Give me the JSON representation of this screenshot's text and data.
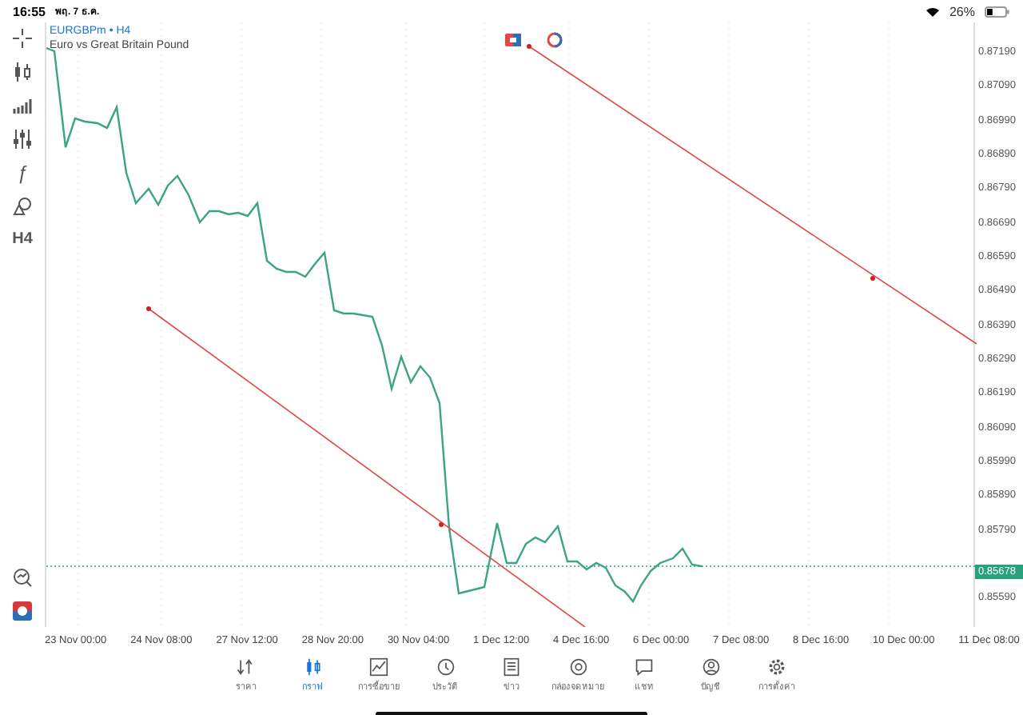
{
  "status_bar": {
    "time": "16:55",
    "date": "พฤ. 7 ธ.ค.",
    "battery": "26%"
  },
  "symbol": {
    "name": "EURGBPm",
    "timeframe": "• H4",
    "description": "Euro vs Great Britain Pound"
  },
  "toolbar": [
    {
      "kind": "crosshair"
    },
    {
      "kind": "candles"
    },
    {
      "kind": "indicators"
    },
    {
      "kind": "sliders"
    },
    {
      "kind": "text",
      "label": "ƒ"
    },
    {
      "kind": "objects"
    },
    {
      "kind": "text",
      "label": "H4"
    }
  ],
  "price_axis": [
    {
      "kind": "tick",
      "label": "0.87190"
    },
    {
      "kind": "tick",
      "label": "0.87090"
    },
    {
      "kind": "tick",
      "label": "0.86990"
    },
    {
      "kind": "tick",
      "label": "0.86890"
    },
    {
      "kind": "tick",
      "label": "0.86790"
    },
    {
      "kind": "tick",
      "label": "0.86690"
    },
    {
      "kind": "tick",
      "label": "0.86590"
    },
    {
      "kind": "tick",
      "label": "0.86490"
    },
    {
      "kind": "tick",
      "label": "0.86390"
    },
    {
      "kind": "tick",
      "label": "0.86290"
    },
    {
      "kind": "tick",
      "label": "0.86190"
    },
    {
      "kind": "tick",
      "label": "0.86090"
    },
    {
      "kind": "tick",
      "label": "0.85990"
    },
    {
      "kind": "tick",
      "label": "0.85890"
    },
    {
      "kind": "tick",
      "label": "0.85790"
    },
    {
      "kind": "current",
      "label": "0.85678"
    },
    {
      "kind": "tick",
      "label": "0.85590"
    }
  ],
  "time_axis": [
    "23 Nov 00:00",
    "24 Nov 08:00",
    "27 Nov 12:00",
    "28 Nov 20:00",
    "30 Nov 04:00",
    "1 Dec 12:00",
    "4 Dec 16:00",
    "6 Dec 00:00",
    "7 Dec 08:00",
    "8 Dec 16:00",
    "10 Dec 00:00",
    "11 Dec 08:00"
  ],
  "tabs": [
    {
      "kind": "quotes",
      "label": "ราคา",
      "selected": false
    },
    {
      "kind": "chart",
      "label": "กราฟ",
      "selected": true
    },
    {
      "kind": "trade",
      "label": "การซื้อขาย",
      "selected": false
    },
    {
      "kind": "history",
      "label": "ประวัติ",
      "selected": false
    },
    {
      "kind": "news",
      "label": "ข่าว",
      "selected": false
    },
    {
      "kind": "mail",
      "label": "กล่องจดหมาย",
      "selected": false
    },
    {
      "kind": "chat",
      "label": "แชท",
      "selected": false
    },
    {
      "kind": "account",
      "label": "บัญชี",
      "selected": false
    },
    {
      "kind": "settings",
      "label": "การตั้งค่า",
      "selected": false
    }
  ]
}
